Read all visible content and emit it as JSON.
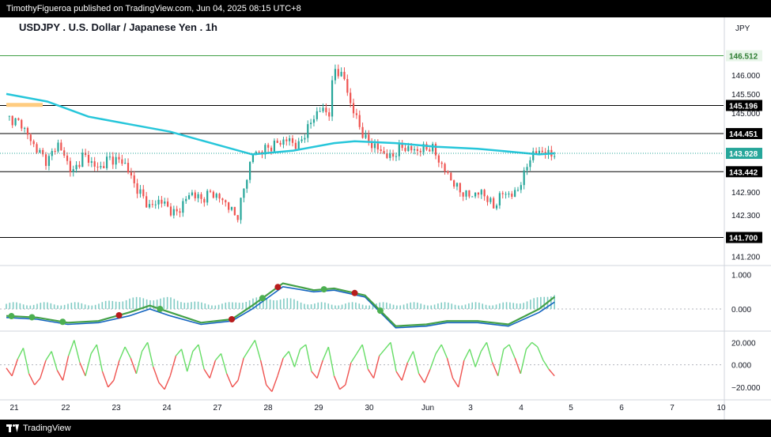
{
  "header": {
    "published": "TimothyFigueroa published on TradingView.com, Jun 04, 2025 08:15 UTC+8"
  },
  "footer": {
    "brand": "TradingView"
  },
  "chart_title": "USDJPY . U.S. Dollar / Japanese Yen . 1h",
  "currency": "JPY",
  "colors": {
    "up": "#26a69a",
    "down": "#ef5350",
    "ma": "#26c6da",
    "macd_fast": "#43a047",
    "macd_slow": "#1565c0",
    "macd_red": "#b71c1c",
    "rsi_up": "#66dd66",
    "rsi_down": "#ef5350"
  },
  "chart_data": [
    {
      "type": "candlestick",
      "title": "USDJPY . U.S. Dollar / Japanese Yen . 1h",
      "x_tick_labels": [
        "21",
        "22",
        "23",
        "24",
        "27",
        "28",
        "29",
        "30",
        "Jun",
        "3",
        "4",
        "5",
        "6",
        "7",
        "10"
      ],
      "y_ticks": [
        141.2,
        142.3,
        142.9,
        143.9,
        145.0,
        145.5,
        146.0
      ],
      "ylim": [
        141.0,
        146.9
      ],
      "horizontal_levels": [
        {
          "value": 146.512,
          "label": "146.512",
          "color": "#43a047"
        },
        {
          "value": 145.196,
          "label": "145.196",
          "color": "#000000"
        },
        {
          "value": 144.451,
          "label": "144.451",
          "color": "#000000"
        },
        {
          "value": 143.442,
          "label": "143.442",
          "color": "#000000"
        },
        {
          "value": 141.7,
          "label": "141.700",
          "color": "#000000"
        }
      ],
      "current_price": {
        "value": 143.928,
        "label": "143.928",
        "color": "#26a69a"
      },
      "price_path": [
        [
          0,
          144.9
        ],
        [
          3,
          144.7
        ],
        [
          5,
          144.2
        ],
        [
          8,
          143.7
        ],
        [
          10,
          144.2
        ],
        [
          13,
          143.4
        ],
        [
          15,
          143.9
        ],
        [
          18,
          143.5
        ],
        [
          20,
          143.8
        ],
        [
          23,
          143.7
        ],
        [
          25,
          143.1
        ],
        [
          28,
          142.5
        ],
        [
          30,
          142.7
        ],
        [
          33,
          142.3
        ],
        [
          36,
          142.9
        ],
        [
          38,
          142.7
        ],
        [
          40,
          142.9
        ],
        [
          43,
          142.6
        ],
        [
          45,
          142.2
        ],
        [
          48,
          143.9
        ],
        [
          50,
          144.0
        ],
        [
          53,
          144.2
        ],
        [
          55,
          144.3
        ],
        [
          57,
          144.1
        ],
        [
          58,
          144.4
        ],
        [
          61,
          145.1
        ],
        [
          63,
          145.0
        ],
        [
          64,
          146.2
        ],
        [
          66,
          145.9
        ],
        [
          67,
          145.3
        ],
        [
          70,
          144.3
        ],
        [
          73,
          144.0
        ],
        [
          75,
          143.8
        ],
        [
          77,
          144.1
        ],
        [
          80,
          144.0
        ],
        [
          83,
          144.1
        ],
        [
          85,
          143.6
        ],
        [
          88,
          143.0
        ],
        [
          90,
          142.8
        ],
        [
          93,
          142.9
        ],
        [
          95,
          142.5
        ],
        [
          97,
          142.9
        ],
        [
          99,
          142.8
        ],
        [
          101,
          143.3
        ],
        [
          102,
          143.8
        ],
        [
          104,
          144.0
        ],
        [
          106,
          143.9
        ],
        [
          107,
          143.93
        ]
      ],
      "moving_average": [
        [
          0,
          145.5
        ],
        [
          8,
          145.3
        ],
        [
          16,
          144.9
        ],
        [
          24,
          144.7
        ],
        [
          32,
          144.5
        ],
        [
          40,
          144.2
        ],
        [
          48,
          143.9
        ],
        [
          56,
          144.0
        ],
        [
          64,
          144.2
        ],
        [
          68,
          144.25
        ],
        [
          76,
          144.2
        ],
        [
          84,
          144.1
        ],
        [
          92,
          144.05
        ],
        [
          100,
          143.95
        ],
        [
          104,
          143.9
        ],
        [
          107,
          143.93
        ]
      ]
    },
    {
      "type": "line",
      "title": "",
      "y_ticks": [
        1.0,
        0.0
      ],
      "ylim": [
        -0.6,
        1.2
      ],
      "series": [
        {
          "values": [
            [
              0,
              -0.2
            ],
            [
              6,
              -0.25
            ],
            [
              12,
              -0.4
            ],
            [
              18,
              -0.35
            ],
            [
              24,
              -0.1
            ],
            [
              28,
              0.1
            ],
            [
              32,
              -0.1
            ],
            [
              38,
              -0.4
            ],
            [
              44,
              -0.3
            ],
            [
              48,
              0.1
            ],
            [
              54,
              0.75
            ],
            [
              60,
              0.55
            ],
            [
              64,
              0.6
            ],
            [
              70,
              0.4
            ],
            [
              76,
              -0.5
            ],
            [
              82,
              -0.45
            ],
            [
              86,
              -0.35
            ],
            [
              92,
              -0.35
            ],
            [
              98,
              -0.45
            ],
            [
              104,
              0.0
            ],
            [
              107,
              0.35
            ]
          ]
        },
        {
          "values": [
            [
              0,
              -0.25
            ],
            [
              6,
              -0.3
            ],
            [
              12,
              -0.45
            ],
            [
              18,
              -0.4
            ],
            [
              24,
              -0.2
            ],
            [
              28,
              0.0
            ],
            [
              32,
              -0.2
            ],
            [
              38,
              -0.45
            ],
            [
              44,
              -0.35
            ],
            [
              48,
              0.0
            ],
            [
              54,
              0.65
            ],
            [
              60,
              0.5
            ],
            [
              64,
              0.55
            ],
            [
              70,
              0.35
            ],
            [
              76,
              -0.55
            ],
            [
              82,
              -0.5
            ],
            [
              86,
              -0.4
            ],
            [
              92,
              -0.4
            ],
            [
              98,
              -0.5
            ],
            [
              104,
              -0.1
            ],
            [
              107,
              0.2
            ]
          ]
        }
      ],
      "signals": [
        {
          "x": 1,
          "color": "green"
        },
        {
          "x": 5,
          "color": "green"
        },
        {
          "x": 11,
          "color": "green"
        },
        {
          "x": 22,
          "color": "red"
        },
        {
          "x": 30,
          "color": "green"
        },
        {
          "x": 44,
          "color": "red"
        },
        {
          "x": 50,
          "color": "green"
        },
        {
          "x": 53,
          "color": "red"
        },
        {
          "x": 62,
          "color": "green"
        },
        {
          "x": 68,
          "color": "red"
        },
        {
          "x": 73,
          "color": "green"
        }
      ]
    },
    {
      "type": "line",
      "title": "",
      "y_ticks": [
        20.0,
        0.0,
        -20.0
      ],
      "ylim": [
        -30,
        28
      ],
      "values": [
        -3,
        -10,
        5,
        15,
        -8,
        -18,
        -12,
        4,
        12,
        -5,
        -14,
        8,
        22,
        2,
        -10,
        10,
        18,
        -6,
        -20,
        -14,
        4,
        16,
        6,
        -8,
        12,
        20,
        -2,
        -16,
        -22,
        -10,
        8,
        14,
        -6,
        12,
        18,
        -4,
        -12,
        4,
        10,
        -8,
        -20,
        -14,
        6,
        14,
        22,
        4,
        -18,
        -24,
        -10,
        6,
        12,
        -2,
        14,
        18,
        -6,
        -12,
        4,
        16,
        -10,
        -22,
        -18,
        2,
        10,
        18,
        -4,
        -12,
        8,
        14,
        20,
        -6,
        -14,
        2,
        12,
        -8,
        -16,
        -4,
        10,
        18,
        6,
        -12,
        -20,
        4,
        14,
        -2,
        12,
        20,
        2,
        -10,
        14,
        18,
        6,
        -8,
        14,
        20,
        16,
        4,
        -4,
        -10
      ]
    }
  ]
}
